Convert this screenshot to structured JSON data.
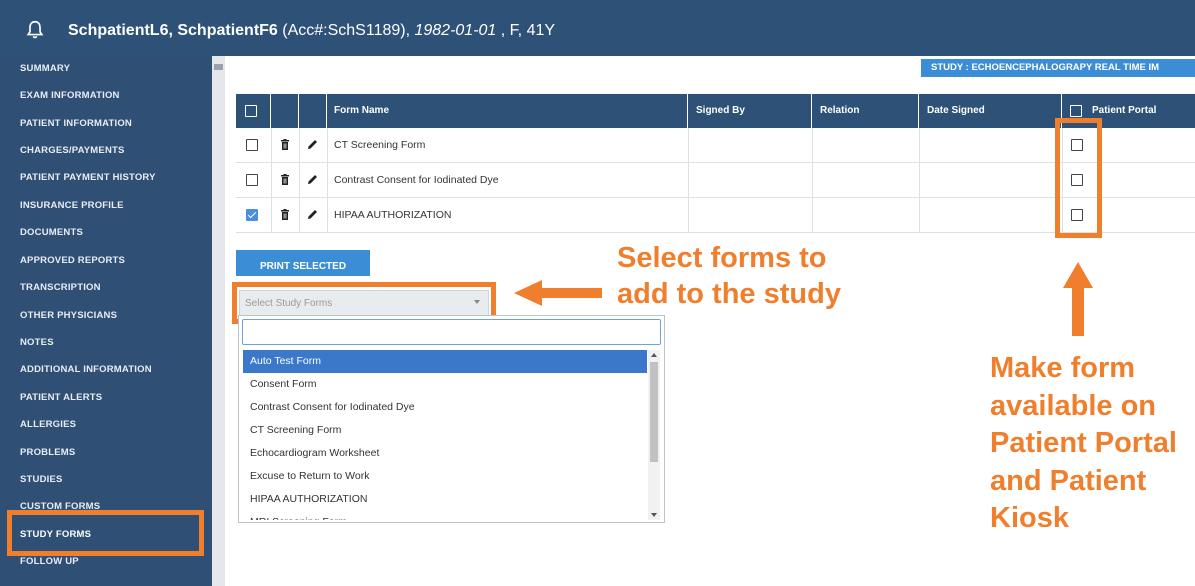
{
  "header": {
    "patient_name": "SchpatientL6, SchpatientF6",
    "account": "(Acc#:SchS1189),",
    "dob": "1982-01-01",
    "sex_age": ", F, 41Y"
  },
  "sidebar": {
    "items": [
      {
        "label": "SUMMARY"
      },
      {
        "label": "EXAM INFORMATION"
      },
      {
        "label": "PATIENT INFORMATION"
      },
      {
        "label": "CHARGES/PAYMENTS"
      },
      {
        "label": "PATIENT PAYMENT HISTORY"
      },
      {
        "label": "INSURANCE PROFILE"
      },
      {
        "label": "DOCUMENTS"
      },
      {
        "label": "APPROVED REPORTS"
      },
      {
        "label": "TRANSCRIPTION"
      },
      {
        "label": "OTHER PHYSICIANS"
      },
      {
        "label": "NOTES"
      },
      {
        "label": "ADDITIONAL INFORMATION"
      },
      {
        "label": "PATIENT ALERTS"
      },
      {
        "label": "ALLERGIES"
      },
      {
        "label": "PROBLEMS"
      },
      {
        "label": "STUDIES"
      },
      {
        "label": "CUSTOM FORMS"
      },
      {
        "label": "STUDY FORMS",
        "active": true
      },
      {
        "label": "FOLLOW UP"
      }
    ]
  },
  "study_banner": "STUDY : ECHOENCEPHALOGRAPY REAL TIME IM",
  "table": {
    "columns": [
      "Form Name",
      "Signed By",
      "Relation",
      "Date Signed",
      "Patient Portal"
    ],
    "rows": [
      {
        "name": "CT Screening Form",
        "checked": false,
        "portal": false
      },
      {
        "name": "Contrast Consent for Iodinated Dye",
        "checked": false,
        "portal": false
      },
      {
        "name": "HIPAA AUTHORIZATION",
        "checked": true,
        "portal": false
      }
    ]
  },
  "print_button": "PRINT SELECTED",
  "select": {
    "placeholder": "Select Study Forms",
    "options": [
      "Auto Test Form",
      "Consent Form",
      "Contrast Consent for Iodinated Dye",
      "CT Screening Form",
      "Echocardiogram Worksheet",
      "Excuse to Return to Work",
      "HIPAA AUTHORIZATION",
      "MRI Screening Form"
    ],
    "highlighted": "Auto Test Form"
  },
  "annotations": {
    "select_forms": "Select forms to add to the study",
    "portal": "Make form available on Patient Portal and Patient Kiosk"
  },
  "colors": {
    "header_bg": "#2e5178",
    "sidebar_bg": "#2f4f75",
    "accent_blue": "#3b8ed6",
    "annotation_orange": "#f07f2d"
  }
}
